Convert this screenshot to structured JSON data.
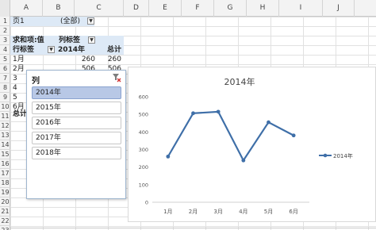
{
  "columns": [
    "A",
    "B",
    "C",
    "D",
    "E",
    "F",
    "G",
    "H",
    "I",
    "J"
  ],
  "rows": [
    "1",
    "2",
    "3",
    "4",
    "5",
    "6",
    "7",
    "8",
    "9",
    "10",
    "11",
    "12",
    "13",
    "14",
    "15",
    "16",
    "17",
    "18",
    "19",
    "20",
    "21",
    "22",
    "23"
  ],
  "pivot": {
    "page_label": "页1",
    "page_value": "(全部)",
    "values_label": "求和项:值",
    "col_labels": "列标签",
    "row_labels": "行标签",
    "col_2014": "2014年",
    "col_total": "总计",
    "rows": [
      {
        "label": "1月",
        "v2014": "260",
        "total": "260"
      },
      {
        "label": "2月",
        "v2014": "506",
        "total": "506"
      },
      {
        "label": "3",
        "v2014": "",
        "total": ""
      },
      {
        "label": "4",
        "v2014": "",
        "total": ""
      },
      {
        "label": "5",
        "v2014": "",
        "total": ""
      },
      {
        "label": "6月",
        "v2014": "",
        "total": ""
      }
    ],
    "grand_total_label": "总计"
  },
  "slicer": {
    "title": "列",
    "filter_icon": "clear-filter-icon",
    "items": [
      {
        "label": "2014年",
        "selected": true
      },
      {
        "label": "2015年",
        "selected": false
      },
      {
        "label": "2016年",
        "selected": false
      },
      {
        "label": "2017年",
        "selected": false
      },
      {
        "label": "2018年",
        "selected": false
      }
    ]
  },
  "colors": {
    "series": "#3f6fa8",
    "pivot_header": "#dde9f6",
    "slicer_selected": "#b8c8e6"
  },
  "chart_data": {
    "type": "line",
    "title": "2014年",
    "categories": [
      "1月",
      "2月",
      "3月",
      "4月",
      "5月",
      "6月"
    ],
    "series": [
      {
        "name": "2014年",
        "values": [
          260,
          506,
          515,
          238,
          455,
          380
        ]
      }
    ],
    "ylim": [
      0,
      600
    ],
    "yticks": [
      "0",
      "100",
      "200",
      "300",
      "400",
      "500",
      "600"
    ],
    "grid": false,
    "legend": "right"
  }
}
